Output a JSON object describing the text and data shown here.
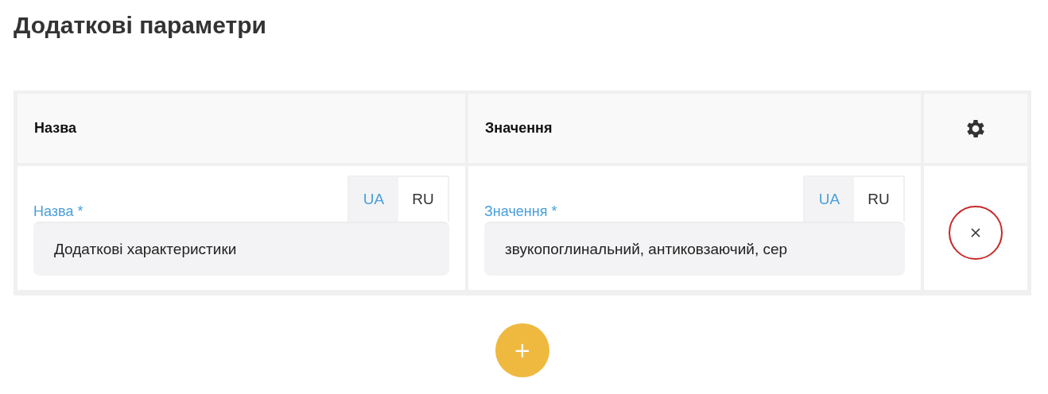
{
  "title": "Додаткові параметри",
  "table": {
    "columns": [
      {
        "kind": "text",
        "label": "Назва"
      },
      {
        "kind": "text",
        "label": "Значення"
      },
      {
        "kind": "settings"
      }
    ],
    "rows": [
      {
        "fields": [
          {
            "label": "Назва *",
            "value": "Додаткові характеристики",
            "languages": [
              {
                "label": "UA",
                "selected": true
              },
              {
                "label": "RU",
                "selected": false
              }
            ]
          },
          {
            "label": "Значення *",
            "value": "звукопоглинальний, антиковзаючий, сер",
            "languages": [
              {
                "label": "UA",
                "selected": true
              },
              {
                "label": "RU",
                "selected": false
              }
            ]
          }
        ]
      }
    ]
  },
  "add_button": {
    "label": "+"
  }
}
